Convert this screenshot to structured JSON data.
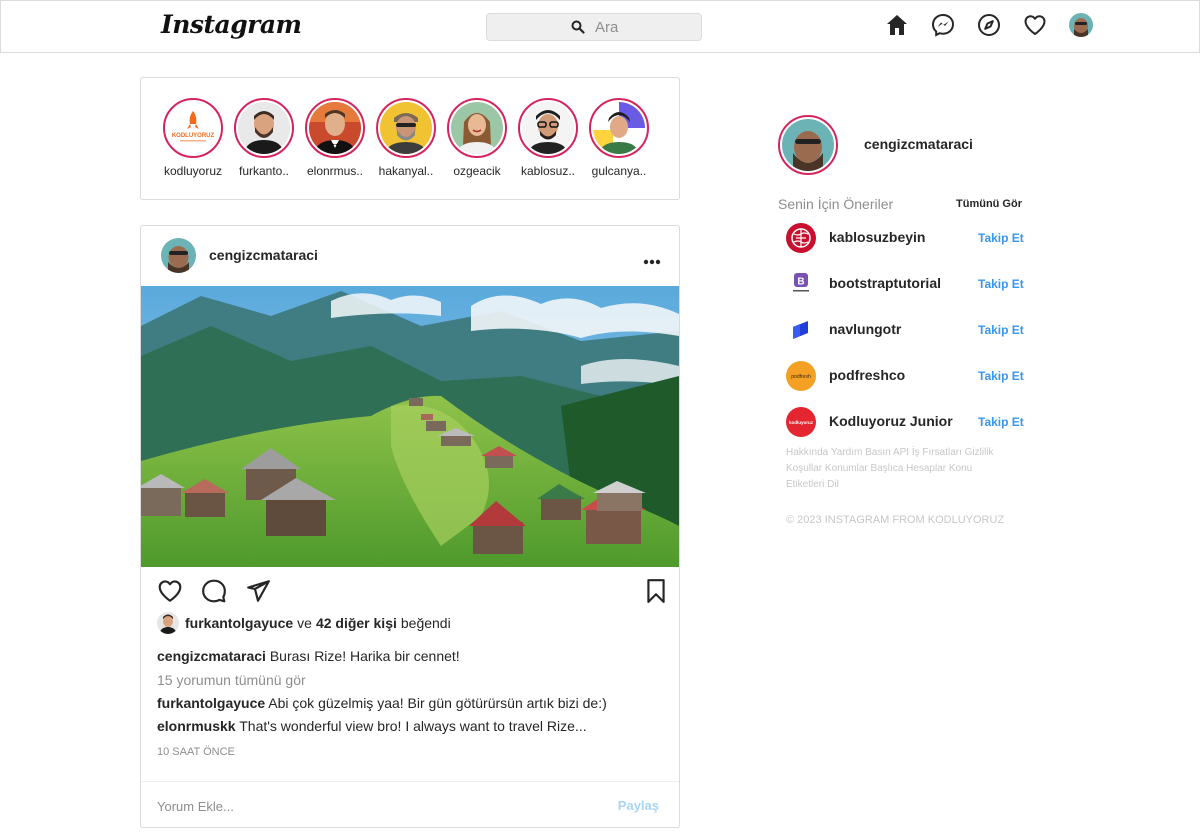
{
  "nav": {
    "logo": "Instagram",
    "search_placeholder": "Ara",
    "icons": [
      "home-icon",
      "messenger-icon",
      "explore-icon",
      "heart-icon",
      "profile-avatar"
    ]
  },
  "stories": [
    {
      "name": "kodluyoruz",
      "logo_text": "KODLUYORUZ"
    },
    {
      "name": "furkanto.."
    },
    {
      "name": "elonrmus.."
    },
    {
      "name": "hakanyal.."
    },
    {
      "name": "ozgeacik"
    },
    {
      "name": "kablosuz.."
    },
    {
      "name": "gulcanya.."
    }
  ],
  "post": {
    "username": "cengizcmataraci",
    "liked_by": "furkantolgayuce",
    "likes_joiner": "ve",
    "likes_others": "42 diğer kişi",
    "likes_suffix": "beğendi",
    "caption_user": "cengizcmataraci",
    "caption_text": "Burası Rize! Harika bir cennet!",
    "view_all": "15 yorumun tümünü gör",
    "comments": [
      {
        "user": "furkantolgayuce",
        "text": "Abi çok güzelmiş yaa! Bir gün götürürsün artık bizi de:)"
      },
      {
        "user": "elonrmuskk",
        "text": "That's wonderful view bro! I always want to travel Rize..."
      }
    ],
    "time": "10 SAAT ÖNCE",
    "comment_placeholder": "Yorum Ekle...",
    "share_label": "Paylaş"
  },
  "sidebar": {
    "username": "cengizcmataraci",
    "suggestions_title": "Senin İçin Öneriler",
    "see_all": "Tümünü Gör",
    "suggestions": [
      {
        "name": "kablosuzbeyin",
        "follow": "Takip Et",
        "color": "#c8102e"
      },
      {
        "name": "bootstraptutorial",
        "follow": "Takip Et",
        "color": "#7952b3",
        "avatar_letter": "B"
      },
      {
        "name": "navlungotr",
        "follow": "Takip Et",
        "color": "#1e3fd8"
      },
      {
        "name": "podfreshco",
        "follow": "Takip Et",
        "color": "#f4a024",
        "avatar_text": "podfresh"
      },
      {
        "name": "Kodluyoruz Junior",
        "follow": "Takip Et",
        "color": "#e3262f",
        "avatar_text": "kodluyoruz"
      }
    ],
    "footer_links": [
      "Hakkında",
      "Yardım",
      "Basın",
      "API",
      "İş Fırsatları",
      "Gizlilik",
      "Koşullar",
      "Konumlar",
      "Başlıca Hesaplar",
      "Konu Etiketleri",
      "Dil"
    ],
    "copyright": "© 2023 INSTAGRAM FROM KODLUYORUZ"
  },
  "colors": {
    "story_ring": "#d6245d",
    "follow": "#3897f0",
    "share_disabled": "#a6d5f7",
    "border": "#dbdbdb"
  }
}
